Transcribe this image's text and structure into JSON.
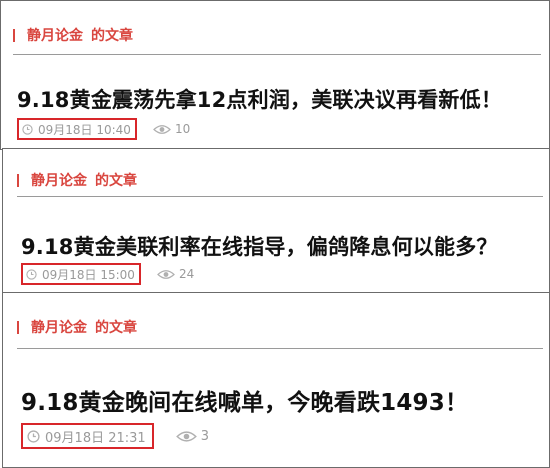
{
  "section_label": "的文章",
  "colors": {
    "accent": "#d9463f",
    "highlight_box": "#d8262a",
    "title": "#111111",
    "meta": "#9a9a9a"
  },
  "icons": {
    "date": "clock-icon",
    "views": "eye-icon"
  },
  "articles": [
    {
      "author": "静月论金",
      "section": "的文章",
      "title": "9.18黄金震荡先拿12点利润，美联决议再看新低！",
      "date": "09月18日 10:40",
      "views": "10"
    },
    {
      "author": "静月论金",
      "section": "的文章",
      "title": "9.18黄金美联利率在线指导，偏鸽降息何以能多？",
      "date": "09月18日 15:00",
      "views": "24"
    },
    {
      "author": "静月论金",
      "section": "的文章",
      "title": "9.18黄金晚间在线喊单，今晚看跌1493！",
      "date": "09月18日 21:31",
      "views": "3"
    }
  ]
}
